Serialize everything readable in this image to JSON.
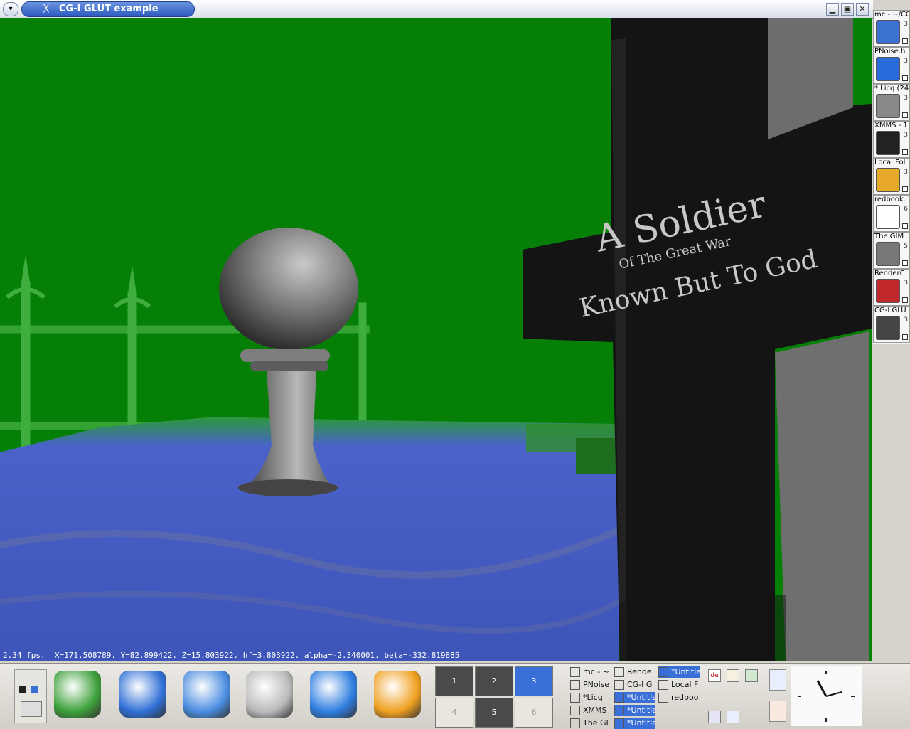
{
  "window": {
    "title": "CG-I GLUT example",
    "menu_glyph": "▾",
    "x_glyph": "ᚷ",
    "buttons": {
      "minimize": "▁",
      "maximize": "▣",
      "close": "✕"
    }
  },
  "scene": {
    "inscription_line1": "A Soldier",
    "inscription_line2": "Of The Great War",
    "inscription_line3": "Known But To God",
    "status_text": "2.34 fps.  X=171.508789. Y=82.899422. Z=15.803922. hf=3.803922. alpha=-2.340001. beta=-332.819885"
  },
  "side_taskbar": {
    "items": [
      {
        "label": "mc - ~/CG",
        "num": "3",
        "icon": "shell-icon",
        "color": "#3b72d2"
      },
      {
        "label": "PNoise.h",
        "num": "3",
        "icon": "konqueror-icon",
        "color": "#2a6bdc"
      },
      {
        "label": "* Licq (24",
        "num": "3",
        "icon": "computer-icon",
        "color": "#888888"
      },
      {
        "label": "XMMS - 1",
        "num": "3",
        "icon": "xmms-icon",
        "color": "#222222"
      },
      {
        "label": "Local Fol",
        "num": "3",
        "icon": "folder-icon",
        "color": "#e7a927"
      },
      {
        "label": "redbook.",
        "num": "6",
        "icon": "document-icon",
        "color": "#ffffff"
      },
      {
        "label": "The GIM",
        "num": "5",
        "icon": "gimp-icon",
        "color": "#777777"
      },
      {
        "label": "RenderC",
        "num": "3",
        "icon": "render-icon",
        "color": "#c0282a"
      },
      {
        "label": "CG-I GLU",
        "num": "3",
        "icon": "x-icon",
        "color": "#444444"
      }
    ]
  },
  "panel": {
    "launchers": [
      {
        "name": "suse-menu-icon",
        "color": "#3da03a"
      },
      {
        "name": "home-icon",
        "color": "#2f6fd6"
      },
      {
        "name": "desktop-icon",
        "color": "#4a8ce0"
      },
      {
        "name": "editor-icon",
        "color": "#b9b9b9"
      },
      {
        "name": "browser-icon",
        "color": "#2e7de0"
      },
      {
        "name": "kmail-icon",
        "color": "#f0a020"
      }
    ],
    "pager": [
      "1",
      "2",
      "3",
      "4",
      "5",
      "6"
    ],
    "pager_active": "3",
    "tasks": [
      {
        "label": "mc - ~",
        "active": false
      },
      {
        "label": "Rende",
        "active": false
      },
      {
        "label": "*Untitle",
        "active": true
      },
      {
        "label": "PNoise",
        "active": false
      },
      {
        "label": "CG-I G",
        "active": false
      },
      {
        "label": "Local F",
        "active": false
      },
      {
        "label": "*Licq",
        "active": false
      },
      {
        "label": "*Untitle",
        "active": true
      },
      {
        "label": "redboo",
        "active": false
      },
      {
        "label": "XMMS",
        "active": false
      },
      {
        "label": "*Untitle",
        "active": true
      },
      {
        "label": "The GI",
        "active": false
      },
      {
        "label": "*Untitle",
        "active": true
      }
    ],
    "tray_keyboard": "de"
  },
  "colors": {
    "sky": "#067f06",
    "floor": "#4a62c9",
    "cross": "#141414",
    "title_blue": "#2c5bbf",
    "pager_active": "#3a6fd8"
  }
}
